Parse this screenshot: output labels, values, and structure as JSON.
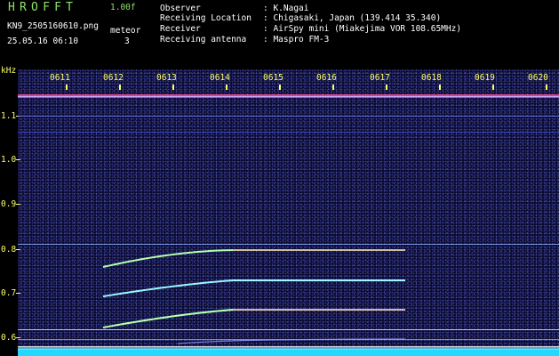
{
  "header": {
    "brand": "HROFFT",
    "version": "1.00f",
    "filename": "KN9_2505160610.png",
    "timestamp": "25.05.16 06:10",
    "meteor_label": "meteor",
    "meteor_count": "3",
    "fields": [
      {
        "label": "Observer",
        "value": ": K.Nagai"
      },
      {
        "label": "Receiving Location",
        "value": ": Chigasaki, Japan (139.414 35.340)"
      },
      {
        "label": "Receiver",
        "value": ": AirSpy mini (Miakejima VOR 108.65MHz)"
      },
      {
        "label": "Receiving antenna",
        "value": ": Maspro FM-3"
      }
    ]
  },
  "axis": {
    "unit": "kHz",
    "y_labels": [
      "1.1",
      "1.0",
      "0.9",
      "0.8",
      "0.7",
      "0.6"
    ],
    "x_labels": [
      "0611",
      "0612",
      "0613",
      "0614",
      "0615",
      "0616",
      "0617",
      "0618",
      "0619",
      "0620"
    ]
  },
  "colors": {
    "bg": "#000000",
    "text": "#ffffff",
    "brand": "#8fe36a",
    "axis": "#ffff66",
    "trace": "#b6ffb0",
    "hot": "#ff4c8a"
  }
}
